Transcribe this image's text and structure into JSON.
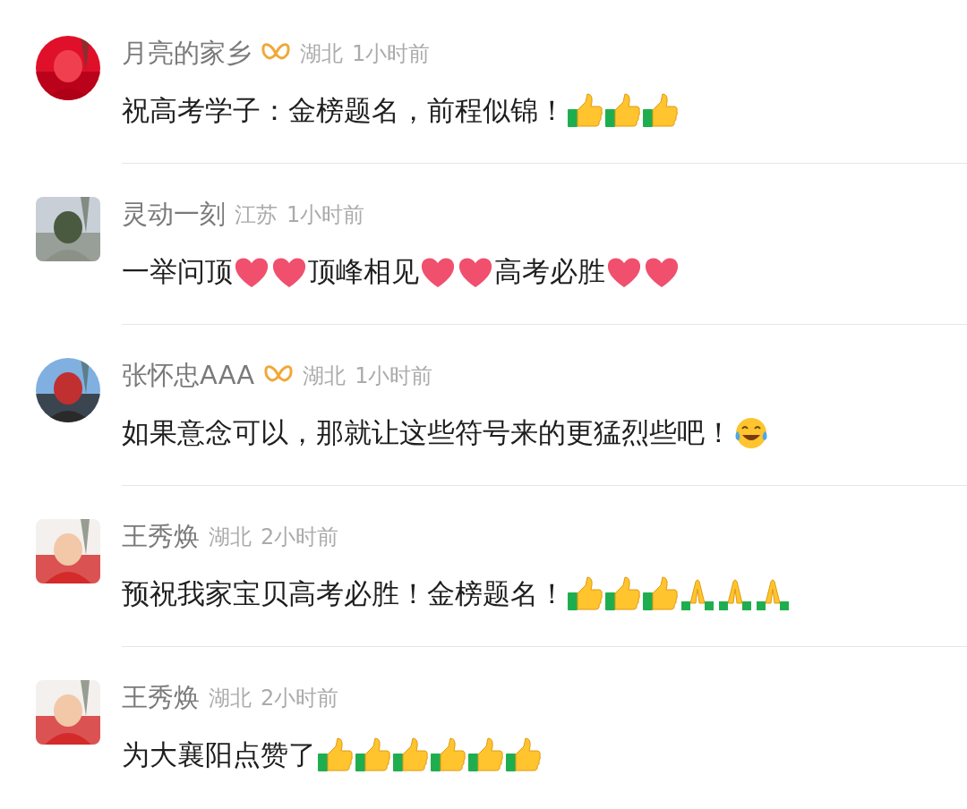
{
  "comments": [
    {
      "name": "月亮的家乡",
      "vip": true,
      "kind": "round_avatar",
      "location": "湖北",
      "time": "1小时前",
      "content": [
        {
          "kind": "text",
          "text": "祝高考学子：金榜题名，前程似锦！"
        },
        {
          "kind": "thumbs_up"
        },
        {
          "kind": "thumbs_up"
        },
        {
          "kind": "thumbs_up"
        }
      ]
    },
    {
      "name": "灵动一刻",
      "vip": false,
      "kind": "square_avatar",
      "location": "江苏",
      "time": "1小时前",
      "content": [
        {
          "kind": "text",
          "text": "一举问顶"
        },
        {
          "kind": "heart"
        },
        {
          "kind": "heart"
        },
        {
          "kind": "text",
          "text": "顶峰相见"
        },
        {
          "kind": "heart"
        },
        {
          "kind": "heart"
        },
        {
          "kind": "text",
          "text": "高考必胜"
        },
        {
          "kind": "heart"
        },
        {
          "kind": "heart"
        }
      ]
    },
    {
      "name": "张怀忠AAA",
      "vip": true,
      "kind": "round_avatar",
      "location": "湖北",
      "time": "1小时前",
      "content": [
        {
          "kind": "text",
          "text": "如果意念可以，那就让这些符号来的更猛烈些吧！"
        },
        {
          "kind": "laughing"
        }
      ]
    },
    {
      "name": "王秀焕",
      "vip": false,
      "kind": "square_avatar",
      "location": "湖北",
      "time": "2小时前",
      "content": [
        {
          "kind": "text",
          "text": "预祝我家宝贝高考必胜！金榜题名！"
        },
        {
          "kind": "thumbs_up"
        },
        {
          "kind": "thumbs_up"
        },
        {
          "kind": "thumbs_up"
        },
        {
          "kind": "praying"
        },
        {
          "kind": "praying"
        },
        {
          "kind": "praying"
        }
      ]
    },
    {
      "name": "王秀焕",
      "vip": false,
      "kind": "square_avatar",
      "location": "湖北",
      "time": "2小时前",
      "content": [
        {
          "kind": "text",
          "text": "为大襄阳点赞了"
        },
        {
          "kind": "thumbs_up"
        },
        {
          "kind": "thumbs_up"
        },
        {
          "kind": "thumbs_up"
        },
        {
          "kind": "thumbs_up"
        },
        {
          "kind": "thumbs_up"
        },
        {
          "kind": "thumbs_up"
        }
      ]
    }
  ]
}
